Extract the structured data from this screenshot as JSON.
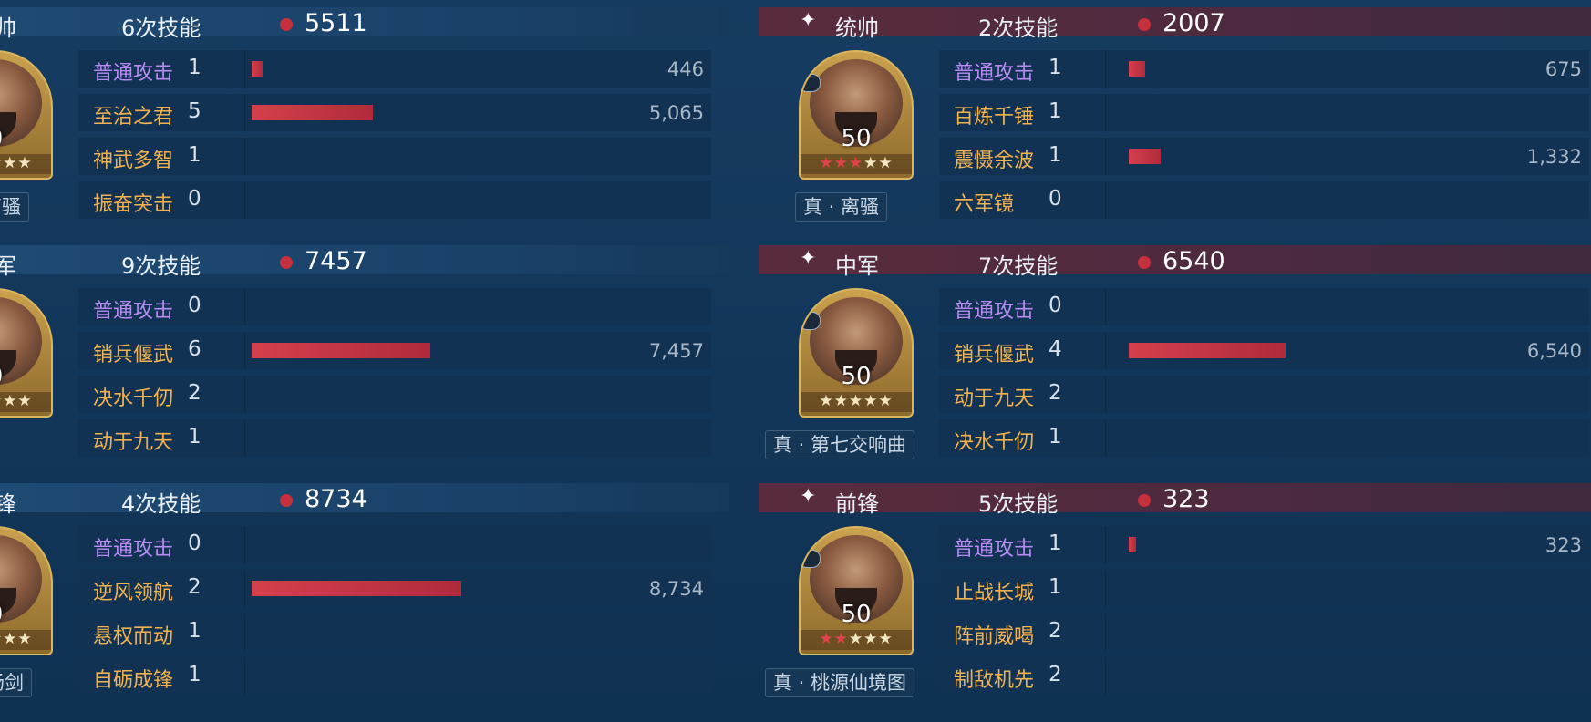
{
  "left": {
    "sections": [
      {
        "role": "帅",
        "count": "6次技能",
        "total": "5511",
        "level": "0",
        "title_tag": "离骚",
        "stars_red": 0,
        "skills": [
          {
            "name": "普通攻击",
            "count": "1",
            "damage": "446",
            "value": 446,
            "purple": true
          },
          {
            "name": "至治之君",
            "count": "5",
            "damage": "5,065",
            "value": 5065,
            "purple": false
          },
          {
            "name": "神武多智",
            "count": "1",
            "damage": "",
            "value": 0,
            "purple": false
          },
          {
            "name": "振奋突击",
            "count": "0",
            "damage": "",
            "value": 0,
            "purple": false
          }
        ]
      },
      {
        "role": "军",
        "count": "9次技能",
        "total": "7457",
        "level": "0",
        "title_tag": "",
        "stars_red": 0,
        "skills": [
          {
            "name": "普通攻击",
            "count": "0",
            "damage": "",
            "value": 0,
            "purple": true
          },
          {
            "name": "销兵偃武",
            "count": "6",
            "damage": "7,457",
            "value": 7457,
            "purple": false
          },
          {
            "name": "决水千仞",
            "count": "2",
            "damage": "",
            "value": 0,
            "purple": false
          },
          {
            "name": "动于九天",
            "count": "1",
            "damage": "",
            "value": 0,
            "purple": false
          }
        ]
      },
      {
        "role": "锋",
        "count": "4次技能",
        "total": "8734",
        "level": "0",
        "title_tag": "鱼肠剑",
        "stars_red": 0,
        "skills": [
          {
            "name": "普通攻击",
            "count": "0",
            "damage": "",
            "value": 0,
            "purple": true
          },
          {
            "name": "逆风领航",
            "count": "2",
            "damage": "8,734",
            "value": 8734,
            "purple": false
          },
          {
            "name": "悬权而动",
            "count": "1",
            "damage": "",
            "value": 0,
            "purple": false
          },
          {
            "name": "自砺成锋",
            "count": "1",
            "damage": "",
            "value": 0,
            "purple": false
          }
        ]
      }
    ]
  },
  "right": {
    "sections": [
      {
        "role": "统帅",
        "count": "2次技能",
        "total": "2007",
        "level": "50",
        "title_tag": "真 · 离骚",
        "stars_red": 3,
        "skills": [
          {
            "name": "普通攻击",
            "count": "1",
            "damage": "675",
            "value": 675,
            "purple": true
          },
          {
            "name": "百炼千锤",
            "count": "1",
            "damage": "",
            "value": 0,
            "purple": false
          },
          {
            "name": "震慑余波",
            "count": "1",
            "damage": "1,332",
            "value": 1332,
            "purple": false
          },
          {
            "name": "六军镜",
            "count": "0",
            "damage": "",
            "value": 0,
            "purple": false
          }
        ]
      },
      {
        "role": "中军",
        "count": "7次技能",
        "total": "6540",
        "level": "50",
        "title_tag": "真 · 第七交响曲",
        "stars_red": 0,
        "skills": [
          {
            "name": "普通攻击",
            "count": "0",
            "damage": "",
            "value": 0,
            "purple": true
          },
          {
            "name": "销兵偃武",
            "count": "4",
            "damage": "6,540",
            "value": 6540,
            "purple": false
          },
          {
            "name": "动于九天",
            "count": "2",
            "damage": "",
            "value": 0,
            "purple": false
          },
          {
            "name": "决水千仞",
            "count": "1",
            "damage": "",
            "value": 0,
            "purple": false
          }
        ]
      },
      {
        "role": "前锋",
        "count": "5次技能",
        "total": "323",
        "level": "50",
        "title_tag": "真 · 桃源仙境图",
        "stars_red": 2,
        "skills": [
          {
            "name": "普通攻击",
            "count": "1",
            "damage": "323",
            "value": 323,
            "purple": true
          },
          {
            "name": "止战长城",
            "count": "1",
            "damage": "",
            "value": 0,
            "purple": false
          },
          {
            "name": "阵前威喝",
            "count": "2",
            "damage": "",
            "value": 0,
            "purple": false
          },
          {
            "name": "制敌机先",
            "count": "2",
            "damage": "",
            "value": 0,
            "purple": false
          }
        ]
      }
    ]
  },
  "star_char": "★",
  "header_icon": "✦",
  "colors": {
    "bar": "#c8363f",
    "skill_gold": "#f1b24f",
    "skill_purple": "#b98cf5",
    "dot": "#c4303c"
  }
}
